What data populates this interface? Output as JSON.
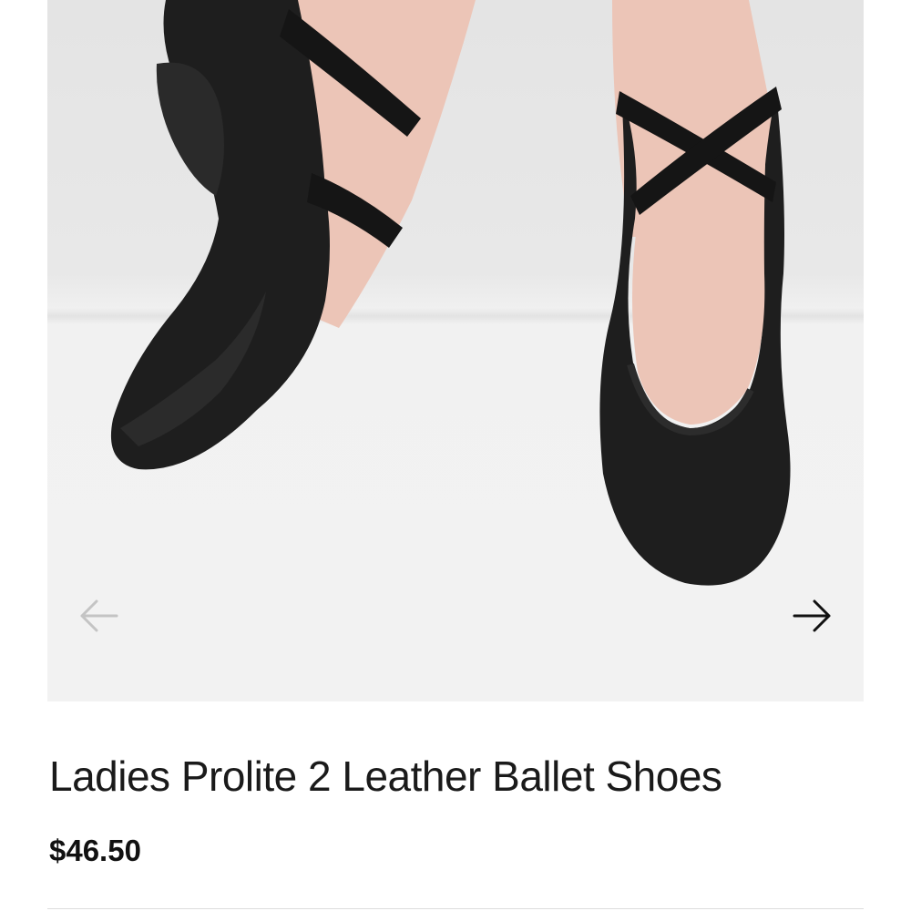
{
  "product": {
    "title": "Ladies Prolite 2 Leather Ballet Shoes",
    "price": "$46.50"
  },
  "gallery": {
    "image_subject": "black leather ballet shoes",
    "prev_icon": "arrow-left-icon",
    "next_icon": "arrow-right-icon",
    "prev_enabled": false,
    "next_enabled": true
  },
  "colors": {
    "shoe": "#1e1e1e",
    "skin": "#ecc5b7",
    "background": "#f2f2f2",
    "text": "#1a1a1a",
    "arrow_disabled": "#c4c4c4",
    "arrow_enabled": "#111111"
  }
}
